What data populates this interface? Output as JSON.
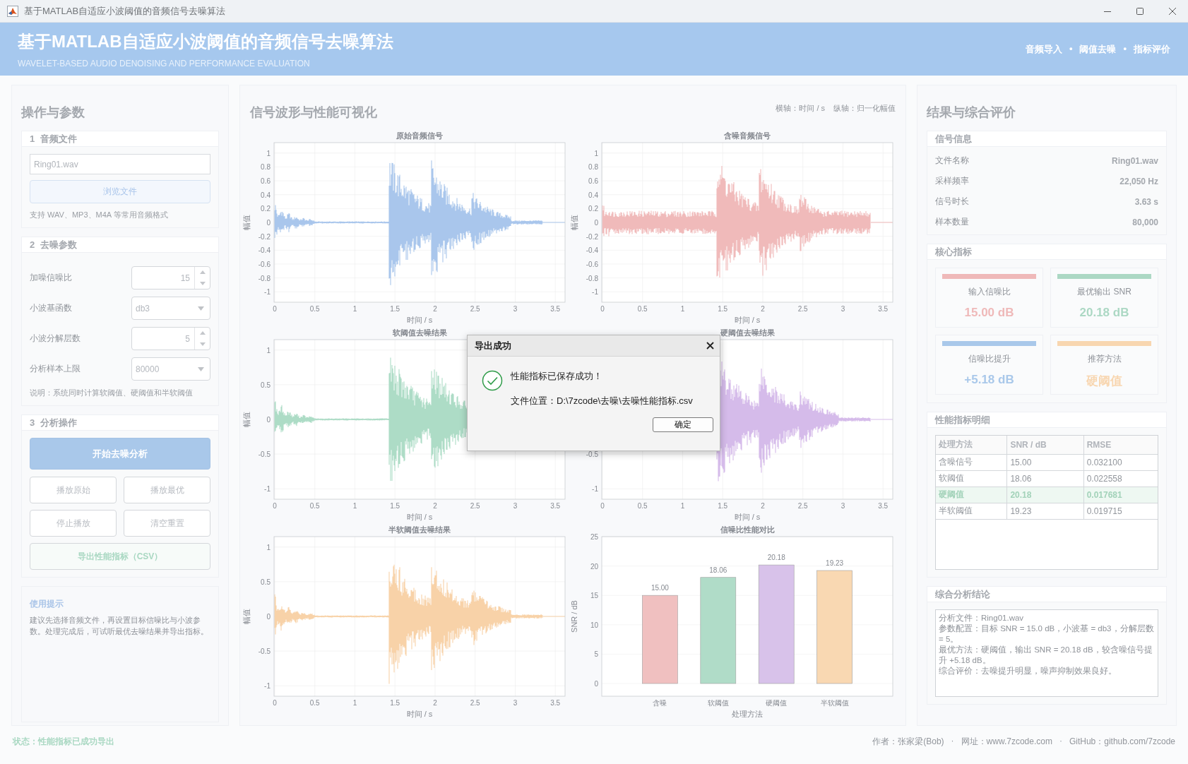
{
  "window": {
    "title": "基于MATLAB自适应小波阈值的音频信号去噪算法"
  },
  "header": {
    "title": "基于MATLAB自适应小波阈值的音频信号去噪算法",
    "subtitle": "WAVELET-BASED AUDIO DENOISING AND PERFORMANCE EVALUATION",
    "steps": [
      "音频导入",
      "阈值去噪",
      "指标评价"
    ],
    "separator": "•"
  },
  "left": {
    "title": "操作与参数",
    "file": {
      "number": "1",
      "title": "音频文件",
      "value": "Ring01.wav",
      "button": "浏览文件",
      "hint": "支持 WAV、MP3、M4A 等常用音频格式"
    },
    "params": {
      "number": "2",
      "title": "去噪参数",
      "fields": [
        {
          "label": "加噪信噪比",
          "kind": "spinner",
          "value": "15"
        },
        {
          "label": "小波基函数",
          "kind": "dropdown",
          "value": "db3"
        },
        {
          "label": "小波分解层数",
          "kind": "spinner",
          "value": "5"
        },
        {
          "label": "分析样本上限",
          "kind": "dropdown",
          "value": "80000"
        }
      ],
      "note": "说明：系统同时计算软阈值、硬阈值和半软阈值"
    },
    "actions": {
      "number": "3",
      "title": "分析操作",
      "primary": "开始去噪分析",
      "buttons": [
        "播放原始",
        "播放最优",
        "停止播放",
        "清空重置"
      ],
      "export": "导出性能指标（CSV）"
    },
    "tips": {
      "title": "使用提示",
      "text": "建议先选择音频文件，再设置目标信噪比与小波参数。处理完成后，可试听最优去噪结果并导出指标。"
    }
  },
  "middle": {
    "title": "信号波形与性能可视化",
    "axis_notes": [
      "横轴：时间 / s",
      "纵轴：归一化幅值"
    ],
    "plots": [
      {
        "kind": "waveform",
        "title": "原始音频信号",
        "color": "#a9c6ec",
        "xlabel": "时间 / s",
        "ylabel": "幅值",
        "xticks": [
          "0",
          "0.5",
          "1",
          "1.5",
          "2",
          "2.5",
          "3",
          "3.5"
        ],
        "yticks": [
          "1",
          "0.8",
          "0.6",
          "0.4",
          "0.2",
          "0",
          "-0.2",
          "-0.4",
          "-0.6",
          "-0.8",
          "-1"
        ]
      },
      {
        "kind": "noisy-waveform",
        "title": "含噪音频信号",
        "color": "#f0baba",
        "xlabel": "时间 / s",
        "ylabel": "幅值",
        "xticks": [
          "0",
          "0.5",
          "1",
          "1.5",
          "2",
          "2.5",
          "3",
          "3.5"
        ],
        "yticks": [
          "1",
          "0.8",
          "0.6",
          "0.4",
          "0.2",
          "0",
          "-0.2",
          "-0.4",
          "-0.6",
          "-0.8",
          "-1"
        ]
      },
      {
        "kind": "waveform",
        "title": "软阈值去噪结果",
        "color": "#addcc6",
        "xlabel": "时间 / s",
        "ylabel": "幅值",
        "xticks": [
          "0",
          "0.5",
          "1",
          "1.5",
          "2",
          "2.5",
          "3",
          "3.5"
        ],
        "yticks": [
          "1",
          "0.5",
          "0",
          "-0.5",
          "-1"
        ]
      },
      {
        "kind": "waveform",
        "title": "硬阈值去噪结果",
        "color": "#d5bbea",
        "xlabel": "时间 / s",
        "xticks": [
          "0",
          "0.5",
          "1",
          "1.5",
          "2",
          "2.5",
          "3",
          "3.5"
        ],
        "yticks": [
          "-0.5",
          "-1"
        ]
      },
      {
        "kind": "waveform",
        "title": "半软阈值去噪结果",
        "color": "#f8d2a8",
        "xlabel": "时间 / s",
        "ylabel": "幅值",
        "xticks": [
          "0",
          "0.5",
          "1",
          "1.5",
          "2",
          "2.5",
          "3",
          "3.5"
        ],
        "yticks": [
          "1",
          "0.5",
          "0",
          "-0.5",
          "-1"
        ]
      },
      {
        "kind": "bar",
        "chart_data": {
          "type": "bar",
          "title": "信噪比性能对比",
          "xlabel": "处理方法",
          "ylabel": "SNR / dB",
          "categories": [
            "含噪",
            "软阈值",
            "硬阈值",
            "半软阈值"
          ],
          "values": [
            15.0,
            18.06,
            20.18,
            19.23
          ],
          "colors": [
            "#f0c0c0",
            "#b0dcc8",
            "#d8c2ea",
            "#f9d8b2"
          ],
          "ylim": [
            0,
            25
          ],
          "grid": true,
          "yticks": [
            0,
            5,
            10,
            15,
            20,
            25
          ],
          "value_labels": [
            "15.00",
            "18.06",
            "20.18",
            "19.23"
          ]
        }
      }
    ]
  },
  "right": {
    "title": "结果与综合评价",
    "info": {
      "title": "信号信息",
      "rows": [
        {
          "label": "文件名称",
          "value": "Ring01.wav"
        },
        {
          "label": "采样频率",
          "value": "22,050 Hz"
        },
        {
          "label": "信号时长",
          "value": "3.63 s"
        },
        {
          "label": "样本数量",
          "value": "80,000"
        }
      ]
    },
    "metrics": {
      "title": "核心指标",
      "cards": [
        {
          "label": "输入信噪比",
          "value": "15.00 dB",
          "color": "#efb9b9"
        },
        {
          "label": "最优输出 SNR",
          "value": "20.18 dB",
          "color": "#acd8c4"
        },
        {
          "label": "信噪比提升",
          "value": "+5.18 dB",
          "color": "#a9c8ea"
        },
        {
          "label": "推荐方法",
          "value": "硬阈值",
          "color": "#f8d6b0"
        }
      ]
    },
    "table": {
      "title": "性能指标明细",
      "columns": [
        "处理方法",
        "SNR / dB",
        "RMSE"
      ],
      "rows": [
        {
          "cells": [
            "含噪信号",
            "15.00",
            "0.032100"
          ],
          "selected": false
        },
        {
          "cells": [
            "软阈值",
            "18.06",
            "0.022558"
          ],
          "selected": false
        },
        {
          "cells": [
            "硬阈值",
            "20.18",
            "0.017681"
          ],
          "selected": true
        },
        {
          "cells": [
            "半软阈值",
            "19.23",
            "0.019715"
          ],
          "selected": false
        }
      ]
    },
    "conclusion": {
      "title": "综合分析结论",
      "lines": [
        "分析文件：Ring01.wav",
        "参数配置：目标 SNR = 15.0 dB，小波基 = db3，分解层数 = 5。",
        "最优方法：硬阈值，输出 SNR = 20.18 dB，较含噪信号提升 +5.18 dB。",
        "综合评价：去噪提升明显，噪声抑制效果良好。"
      ]
    }
  },
  "status_bar": {
    "status": "状态：性能指标已成功导出",
    "credits": [
      "作者：张家梁(Bob)",
      "网址：www.7zcode.com",
      "GitHub：github.com/7zcode"
    ],
    "separator": "·"
  },
  "dialog": {
    "title": "导出成功",
    "message": "性能指标已保存成功！",
    "path": "文件位置：D:\\7zcode\\去噪\\去噪性能指标.csv",
    "button": "确定"
  }
}
